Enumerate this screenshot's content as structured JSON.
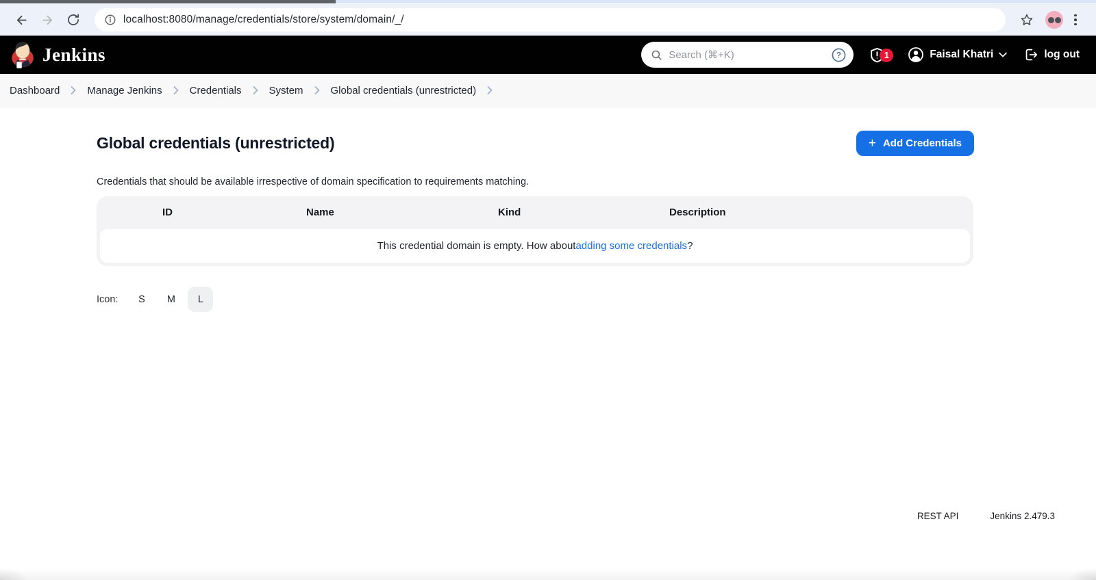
{
  "browser": {
    "url": "localhost:8080/manage/credentials/store/system/domain/_/"
  },
  "header": {
    "brand": "Jenkins",
    "search_placeholder": "Search (⌘+K)",
    "notification_count": "1",
    "user_name": "Faisal Khatri",
    "logout_label": "log out"
  },
  "breadcrumb": {
    "items": [
      "Dashboard",
      "Manage Jenkins",
      "Credentials",
      "System",
      "Global credentials (unrestricted)"
    ]
  },
  "page": {
    "title": "Global credentials (unrestricted)",
    "add_button_label": "Add Credentials",
    "description": "Credentials that should be available irrespective of domain specification to requirements matching.",
    "table": {
      "columns": [
        "ID",
        "Name",
        "Kind",
        "Description"
      ],
      "empty_text_prefix": "This credential domain is empty. How about ",
      "empty_link_text": "adding some credentials",
      "empty_text_suffix": "?"
    },
    "icon_size": {
      "label": "Icon:",
      "options": [
        "S",
        "M",
        "L"
      ],
      "selected": "L"
    }
  },
  "footer": {
    "rest_api_label": "REST API",
    "version_label": "Jenkins 2.479.3"
  },
  "colors": {
    "accent": "#1570e6",
    "badge": "#e51937",
    "header_bg": "#010102",
    "toolbar_bg": "#edf1f9"
  }
}
